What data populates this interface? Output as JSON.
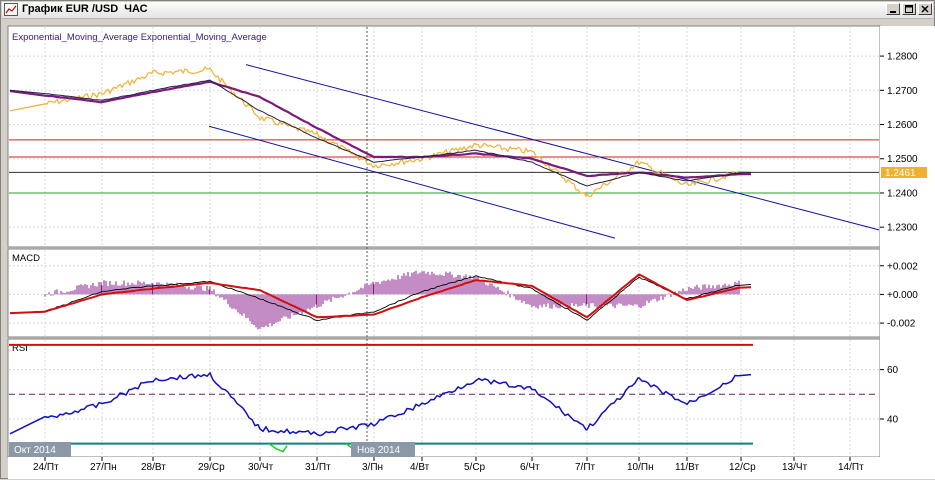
{
  "window": {
    "title": "График EUR /USD  ЧАС",
    "buttons": {
      "minimize": "minimize-icon",
      "maximize": "maximize-icon",
      "close": "close-icon"
    }
  },
  "price_panel": {
    "legend": "Exponential_Moving_Average  Exponential_Moving_Average",
    "price_ticks": [
      "1.2800",
      "1.2700",
      "1.2600",
      "1.2500",
      "1.2400",
      "1.2300"
    ],
    "current_price": "1.2461",
    "colors": {
      "price": "#f0b030",
      "ema_slow": "#7a1a7a",
      "ema_fast": "#202040",
      "channel": "#1010a0",
      "resistance": "#d02020",
      "support": "#20a020"
    }
  },
  "macd_panel": {
    "label": "MACD",
    "ticks": [
      "+0.002",
      "+0.000",
      "-0.002"
    ],
    "colors": {
      "macd": "#000000",
      "signal": "#d01010",
      "histogram": "#8a1a8a"
    }
  },
  "rsi_panel": {
    "label": "RSI",
    "ticks": [
      "60",
      "40"
    ],
    "colors": {
      "rsi": "#1010c0",
      "overbought": "#d01010",
      "oversold": "#108080",
      "middle": "#6a1a6a"
    }
  },
  "month_labels": [
    "Окт 2014",
    "Нов 2014"
  ],
  "date_labels": [
    "24/Пт",
    "27/Пн",
    "28/Вт",
    "29/Ср",
    "30/Чт",
    "31/Пт",
    "3/Пн",
    "4/Вт",
    "5/Ср",
    "6/Чт",
    "7/Пт",
    "10/Пн",
    "11/Вт",
    "12/Ср",
    "13/Чт",
    "14/Пт"
  ],
  "chart_data": [
    {
      "type": "line",
      "series": [
        {
          "name": "Exponential_Moving_Average",
          "x": [
            "24/Пт",
            "27/Пн",
            "28/Вт",
            "29/Ср",
            "30/Чт",
            "31/Пт",
            "3/Пн",
            "4/Вт",
            "5/Ср",
            "6/Чт",
            "7/Пт",
            "10/Пн",
            "11/Вт",
            "12/Ср"
          ],
          "y": [
            1.2685,
            1.2665,
            1.2695,
            1.2725,
            1.268,
            1.259,
            1.2505,
            1.2505,
            1.2515,
            1.25,
            1.245,
            1.246,
            1.2445,
            1.2455
          ]
        },
        {
          "name": "Exponential_Moving_Average",
          "x": [
            "24/Пт",
            "27/Пн",
            "28/Вт",
            "29/Ср",
            "30/Чт",
            "31/Пт",
            "3/Пн",
            "4/Вт",
            "5/Ср",
            "6/Чт",
            "7/Пт",
            "10/Пн",
            "11/Вт",
            "12/Ср"
          ],
          "y": [
            1.269,
            1.267,
            1.27,
            1.273,
            1.264,
            1.256,
            1.249,
            1.2505,
            1.2525,
            1.249,
            1.242,
            1.246,
            1.2435,
            1.246
          ]
        }
      ],
      "price": {
        "x": [
          "24/Пт",
          "27/Пн",
          "28/Вт",
          "29/Ср",
          "30/Чт",
          "31/Пт",
          "3/Пн",
          "4/Вт",
          "5/Ср",
          "6/Чт",
          "7/Пт",
          "10/Пн",
          "11/Вт",
          "12/Ср"
        ],
        "y": [
          1.266,
          1.269,
          1.275,
          1.276,
          1.262,
          1.257,
          1.248,
          1.25,
          1.254,
          1.252,
          1.239,
          1.249,
          1.242,
          1.2461
        ]
      },
      "ylim": [
        1.2245,
        1.2885
      ],
      "yticks": [
        1.28,
        1.27,
        1.26,
        1.25,
        1.24,
        1.23
      ],
      "resistance": [
        1.2555,
        1.2505,
        1.246
      ],
      "support": [
        1.24
      ]
    },
    {
      "type": "line",
      "series": [
        {
          "name": "MACD",
          "x": [
            "24/Пт",
            "27/Пн",
            "28/Вт",
            "29/Ср",
            "30/Чт",
            "31/Пт",
            "3/Пн",
            "4/Вт",
            "5/Ср",
            "6/Чт",
            "7/Пт",
            "10/Пн",
            "11/Вт",
            "12/Ср"
          ],
          "y": [
            -0.0012,
            0.0002,
            0.0006,
            0.0009,
            -0.0003,
            -0.0018,
            -0.0012,
            0.0002,
            0.0013,
            0.0004,
            -0.0018,
            0.0012,
            -0.0003,
            0.0007
          ]
        },
        {
          "name": "",
          "x": [
            "24/Пт",
            "27/Пн",
            "28/Вт",
            "29/Ср",
            "30/Чт",
            "31/Пт",
            "3/Пн",
            "4/Вт",
            "5/Ср",
            "6/Чт",
            "7/Пт",
            "10/Пн",
            "11/Вт",
            "12/Ср"
          ],
          "y": [
            -0.0012,
            0.0,
            0.0004,
            0.0008,
            0.0003,
            -0.0016,
            -0.0014,
            -0.0002,
            0.001,
            0.0006,
            -0.0016,
            0.0014,
            -0.0004,
            0.0005
          ]
        }
      ],
      "ylim": [
        -0.0029,
        0.0031
      ],
      "yticks": [
        0.002,
        0.0,
        -0.002
      ]
    },
    {
      "type": "line",
      "series": [
        {
          "name": "RSI",
          "x": [
            "24/Пт",
            "27/Пн",
            "28/Вт",
            "29/Ср",
            "30/Чт",
            "31/Пт",
            "3/Пн",
            "4/Вт",
            "5/Ср",
            "6/Чт",
            "7/Пт",
            "10/Пн",
            "11/Вт",
            "12/Ср"
          ],
          "y": [
            40,
            46,
            56,
            58,
            36,
            34,
            38,
            46,
            56,
            52,
            36,
            56,
            46,
            58
          ]
        }
      ],
      "levels": {
        "overbought": 70,
        "middle": 50,
        "oversold": 30
      },
      "ylim": [
        25,
        72
      ],
      "yticks": [
        60,
        40
      ]
    }
  ]
}
